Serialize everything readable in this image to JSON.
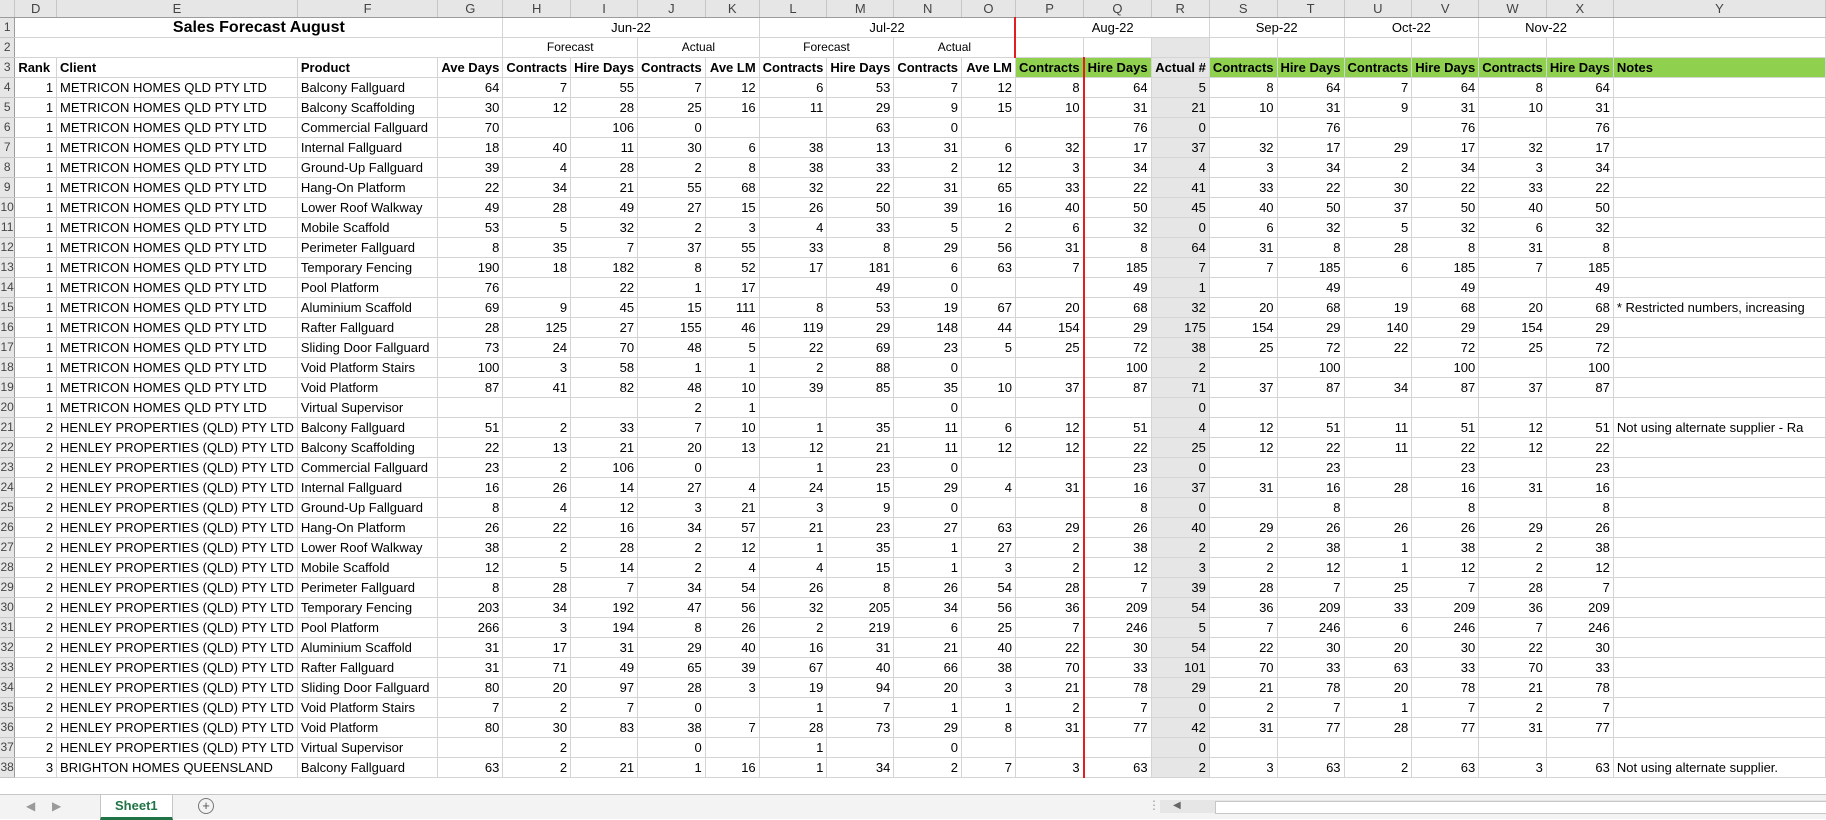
{
  "sheet": {
    "columns": [
      "D",
      "E",
      "F",
      "G",
      "H",
      "I",
      "J",
      "K",
      "L",
      "M",
      "N",
      "O",
      "P",
      "Q",
      "R",
      "S",
      "T",
      "U",
      "V",
      "W",
      "X",
      "Y"
    ],
    "title": "Sales Forecast August",
    "months": {
      "jun": "Jun-22",
      "jul": "Jul-22",
      "aug": "Aug-22",
      "sep": "Sep-22",
      "oct": "Oct-22",
      "nov": "Nov-22"
    },
    "sub": {
      "forecast": "Forecast",
      "actual": "Actual"
    },
    "headers": [
      "Rank",
      "Client",
      "Product",
      "Ave Days",
      "Contracts",
      "Hire Days",
      "Contracts",
      "Ave LM",
      "Contracts",
      "Hire Days",
      "Contracts",
      "Ave LM",
      "Contracts",
      "Hire Days",
      "Actual #",
      "Contracts",
      "Hire Days",
      "Contracts",
      "Hire Days",
      "Contracts",
      "Hire Days",
      "Notes"
    ],
    "rows": [
      [
        "4",
        "1",
        "METRICON HOMES QLD PTY LTD",
        "Balcony Fallguard",
        "64",
        "7",
        "55",
        "7",
        "12",
        "6",
        "53",
        "7",
        "12",
        "8",
        "64",
        "5",
        "8",
        "64",
        "7",
        "64",
        "8",
        "64",
        ""
      ],
      [
        "5",
        "1",
        "METRICON HOMES QLD PTY LTD",
        "Balcony Scaffolding",
        "30",
        "12",
        "28",
        "25",
        "16",
        "11",
        "29",
        "9",
        "15",
        "10",
        "31",
        "21",
        "10",
        "31",
        "9",
        "31",
        "10",
        "31",
        ""
      ],
      [
        "6",
        "1",
        "METRICON HOMES QLD PTY LTD",
        "Commercial Fallguard",
        "70",
        "",
        "106",
        "0",
        "",
        "",
        "63",
        "0",
        "",
        "",
        "76",
        "0",
        "",
        "76",
        "",
        "76",
        "",
        "76",
        ""
      ],
      [
        "7",
        "1",
        "METRICON HOMES QLD PTY LTD",
        "Internal Fallguard",
        "18",
        "40",
        "11",
        "30",
        "6",
        "38",
        "13",
        "31",
        "6",
        "32",
        "17",
        "37",
        "32",
        "17",
        "29",
        "17",
        "32",
        "17",
        ""
      ],
      [
        "8",
        "1",
        "METRICON HOMES QLD PTY LTD",
        "Ground-Up Fallguard",
        "39",
        "4",
        "28",
        "2",
        "8",
        "38",
        "33",
        "2",
        "12",
        "3",
        "34",
        "4",
        "3",
        "34",
        "2",
        "34",
        "3",
        "34",
        ""
      ],
      [
        "9",
        "1",
        "METRICON HOMES QLD PTY LTD",
        "Hang-On Platform",
        "22",
        "34",
        "21",
        "55",
        "68",
        "32",
        "22",
        "31",
        "65",
        "33",
        "22",
        "41",
        "33",
        "22",
        "30",
        "22",
        "33",
        "22",
        ""
      ],
      [
        "10",
        "1",
        "METRICON HOMES QLD PTY LTD",
        "Lower Roof Walkway",
        "49",
        "28",
        "49",
        "27",
        "15",
        "26",
        "50",
        "39",
        "16",
        "40",
        "50",
        "45",
        "40",
        "50",
        "37",
        "50",
        "40",
        "50",
        ""
      ],
      [
        "11",
        "1",
        "METRICON HOMES QLD PTY LTD",
        "Mobile Scaffold",
        "53",
        "5",
        "32",
        "2",
        "3",
        "4",
        "33",
        "5",
        "2",
        "6",
        "32",
        "0",
        "6",
        "32",
        "5",
        "32",
        "6",
        "32",
        ""
      ],
      [
        "12",
        "1",
        "METRICON HOMES QLD PTY LTD",
        "Perimeter Fallguard",
        "8",
        "35",
        "7",
        "37",
        "55",
        "33",
        "8",
        "29",
        "56",
        "31",
        "8",
        "64",
        "31",
        "8",
        "28",
        "8",
        "31",
        "8",
        ""
      ],
      [
        "13",
        "1",
        "METRICON HOMES QLD PTY LTD",
        "Temporary Fencing",
        "190",
        "18",
        "182",
        "8",
        "52",
        "17",
        "181",
        "6",
        "63",
        "7",
        "185",
        "7",
        "7",
        "185",
        "6",
        "185",
        "7",
        "185",
        ""
      ],
      [
        "14",
        "1",
        "METRICON HOMES QLD PTY LTD",
        "Pool Platform",
        "76",
        "",
        "22",
        "1",
        "17",
        "",
        "49",
        "0",
        "",
        "",
        "49",
        "1",
        "",
        "49",
        "",
        "49",
        "",
        "49",
        ""
      ],
      [
        "15",
        "1",
        "METRICON HOMES QLD PTY LTD",
        "Aluminium Scaffold",
        "69",
        "9",
        "45",
        "15",
        "111",
        "8",
        "53",
        "19",
        "67",
        "20",
        "68",
        "32",
        "20",
        "68",
        "19",
        "68",
        "20",
        "68",
        "* Restricted numbers, increasing"
      ],
      [
        "16",
        "1",
        "METRICON HOMES QLD PTY LTD",
        "Rafter Fallguard",
        "28",
        "125",
        "27",
        "155",
        "46",
        "119",
        "29",
        "148",
        "44",
        "154",
        "29",
        "175",
        "154",
        "29",
        "140",
        "29",
        "154",
        "29",
        ""
      ],
      [
        "17",
        "1",
        "METRICON HOMES QLD PTY LTD",
        "Sliding Door Fallguard",
        "73",
        "24",
        "70",
        "48",
        "5",
        "22",
        "69",
        "23",
        "5",
        "25",
        "72",
        "38",
        "25",
        "72",
        "22",
        "72",
        "25",
        "72",
        ""
      ],
      [
        "18",
        "1",
        "METRICON HOMES QLD PTY LTD",
        "Void Platform Stairs",
        "100",
        "3",
        "58",
        "1",
        "1",
        "2",
        "88",
        "0",
        "",
        "",
        "100",
        "2",
        "",
        "100",
        "",
        "100",
        "",
        "100",
        ""
      ],
      [
        "19",
        "1",
        "METRICON HOMES QLD PTY LTD",
        "Void Platform",
        "87",
        "41",
        "82",
        "48",
        "10",
        "39",
        "85",
        "35",
        "10",
        "37",
        "87",
        "71",
        "37",
        "87",
        "34",
        "87",
        "37",
        "87",
        ""
      ],
      [
        "20",
        "1",
        "METRICON HOMES QLD PTY LTD",
        "Virtual Supervisor",
        "",
        "",
        "",
        "2",
        "1",
        "",
        "",
        "0",
        "",
        "",
        "",
        "0",
        "",
        "",
        "",
        "",
        "",
        "",
        ""
      ],
      [
        "21",
        "2",
        "HENLEY PROPERTIES (QLD) PTY LTD",
        "Balcony Fallguard",
        "51",
        "2",
        "33",
        "7",
        "10",
        "1",
        "35",
        "11",
        "6",
        "12",
        "51",
        "4",
        "12",
        "51",
        "11",
        "51",
        "12",
        "51",
        "Not using alternate supplier - Ra"
      ],
      [
        "22",
        "2",
        "HENLEY PROPERTIES (QLD) PTY LTD",
        "Balcony Scaffolding",
        "22",
        "13",
        "21",
        "20",
        "13",
        "12",
        "21",
        "11",
        "12",
        "12",
        "22",
        "25",
        "12",
        "22",
        "11",
        "22",
        "12",
        "22",
        ""
      ],
      [
        "23",
        "2",
        "HENLEY PROPERTIES (QLD) PTY LTD",
        "Commercial Fallguard",
        "23",
        "2",
        "106",
        "0",
        "",
        "1",
        "23",
        "0",
        "",
        "",
        "23",
        "0",
        "",
        "23",
        "",
        "23",
        "",
        "23",
        ""
      ],
      [
        "24",
        "2",
        "HENLEY PROPERTIES (QLD) PTY LTD",
        "Internal Fallguard",
        "16",
        "26",
        "14",
        "27",
        "4",
        "24",
        "15",
        "29",
        "4",
        "31",
        "16",
        "37",
        "31",
        "16",
        "28",
        "16",
        "31",
        "16",
        ""
      ],
      [
        "25",
        "2",
        "HENLEY PROPERTIES (QLD) PTY LTD",
        "Ground-Up Fallguard",
        "8",
        "4",
        "12",
        "3",
        "21",
        "3",
        "9",
        "0",
        "",
        "",
        "8",
        "0",
        "",
        "8",
        "",
        "8",
        "",
        "8",
        ""
      ],
      [
        "26",
        "2",
        "HENLEY PROPERTIES (QLD) PTY LTD",
        "Hang-On Platform",
        "26",
        "22",
        "16",
        "34",
        "57",
        "21",
        "23",
        "27",
        "63",
        "29",
        "26",
        "40",
        "29",
        "26",
        "26",
        "26",
        "29",
        "26",
        ""
      ],
      [
        "27",
        "2",
        "HENLEY PROPERTIES (QLD) PTY LTD",
        "Lower Roof Walkway",
        "38",
        "2",
        "28",
        "2",
        "12",
        "1",
        "35",
        "1",
        "27",
        "2",
        "38",
        "2",
        "2",
        "38",
        "1",
        "38",
        "2",
        "38",
        ""
      ],
      [
        "28",
        "2",
        "HENLEY PROPERTIES (QLD) PTY LTD",
        "Mobile Scaffold",
        "12",
        "5",
        "14",
        "2",
        "4",
        "4",
        "15",
        "1",
        "3",
        "2",
        "12",
        "3",
        "2",
        "12",
        "1",
        "12",
        "2",
        "12",
        ""
      ],
      [
        "29",
        "2",
        "HENLEY PROPERTIES (QLD) PTY LTD",
        "Perimeter Fallguard",
        "8",
        "28",
        "7",
        "34",
        "54",
        "26",
        "8",
        "26",
        "54",
        "28",
        "7",
        "39",
        "28",
        "7",
        "25",
        "7",
        "28",
        "7",
        ""
      ],
      [
        "30",
        "2",
        "HENLEY PROPERTIES (QLD) PTY LTD",
        "Temporary Fencing",
        "203",
        "34",
        "192",
        "47",
        "56",
        "32",
        "205",
        "34",
        "56",
        "36",
        "209",
        "54",
        "36",
        "209",
        "33",
        "209",
        "36",
        "209",
        ""
      ],
      [
        "31",
        "2",
        "HENLEY PROPERTIES (QLD) PTY LTD",
        "Pool Platform",
        "266",
        "3",
        "194",
        "8",
        "26",
        "2",
        "219",
        "6",
        "25",
        "7",
        "246",
        "5",
        "7",
        "246",
        "6",
        "246",
        "7",
        "246",
        ""
      ],
      [
        "32",
        "2",
        "HENLEY PROPERTIES (QLD) PTY LTD",
        "Aluminium Scaffold",
        "31",
        "17",
        "31",
        "29",
        "40",
        "16",
        "31",
        "21",
        "40",
        "22",
        "30",
        "54",
        "22",
        "30",
        "20",
        "30",
        "22",
        "30",
        ""
      ],
      [
        "33",
        "2",
        "HENLEY PROPERTIES (QLD) PTY LTD",
        "Rafter Fallguard",
        "31",
        "71",
        "49",
        "65",
        "39",
        "67",
        "40",
        "66",
        "38",
        "70",
        "33",
        "101",
        "70",
        "33",
        "63",
        "33",
        "70",
        "33",
        ""
      ],
      [
        "34",
        "2",
        "HENLEY PROPERTIES (QLD) PTY LTD",
        "Sliding Door Fallguard",
        "80",
        "20",
        "97",
        "28",
        "3",
        "19",
        "94",
        "20",
        "3",
        "21",
        "78",
        "29",
        "21",
        "78",
        "20",
        "78",
        "21",
        "78",
        ""
      ],
      [
        "35",
        "2",
        "HENLEY PROPERTIES (QLD) PTY LTD",
        "Void Platform Stairs",
        "7",
        "2",
        "7",
        "0",
        "",
        "1",
        "7",
        "1",
        "1",
        "2",
        "7",
        "0",
        "2",
        "7",
        "1",
        "7",
        "2",
        "7",
        ""
      ],
      [
        "36",
        "2",
        "HENLEY PROPERTIES (QLD) PTY LTD",
        "Void Platform",
        "80",
        "30",
        "83",
        "38",
        "7",
        "28",
        "73",
        "29",
        "8",
        "31",
        "77",
        "42",
        "31",
        "77",
        "28",
        "77",
        "31",
        "77",
        ""
      ],
      [
        "37",
        "2",
        "HENLEY PROPERTIES (QLD) PTY LTD",
        "Virtual Supervisor",
        "",
        "2",
        "",
        "0",
        "",
        "1",
        "",
        "0",
        "",
        "",
        "",
        "0",
        "",
        "",
        "",
        "",
        "",
        "",
        ""
      ],
      [
        "38",
        "3",
        "BRIGHTON HOMES QUEENSLAND",
        "Balcony Fallguard",
        "63",
        "2",
        "21",
        "1",
        "16",
        "1",
        "34",
        "2",
        "7",
        "3",
        "63",
        "2",
        "3",
        "63",
        "2",
        "63",
        "3",
        "63",
        "Not using alternate supplier."
      ]
    ]
  },
  "tabs": {
    "active": "Sheet1",
    "add": "+"
  },
  "colors": {
    "green": "#8fd14f",
    "red": "#e02020",
    "excel_green": "#217346"
  }
}
